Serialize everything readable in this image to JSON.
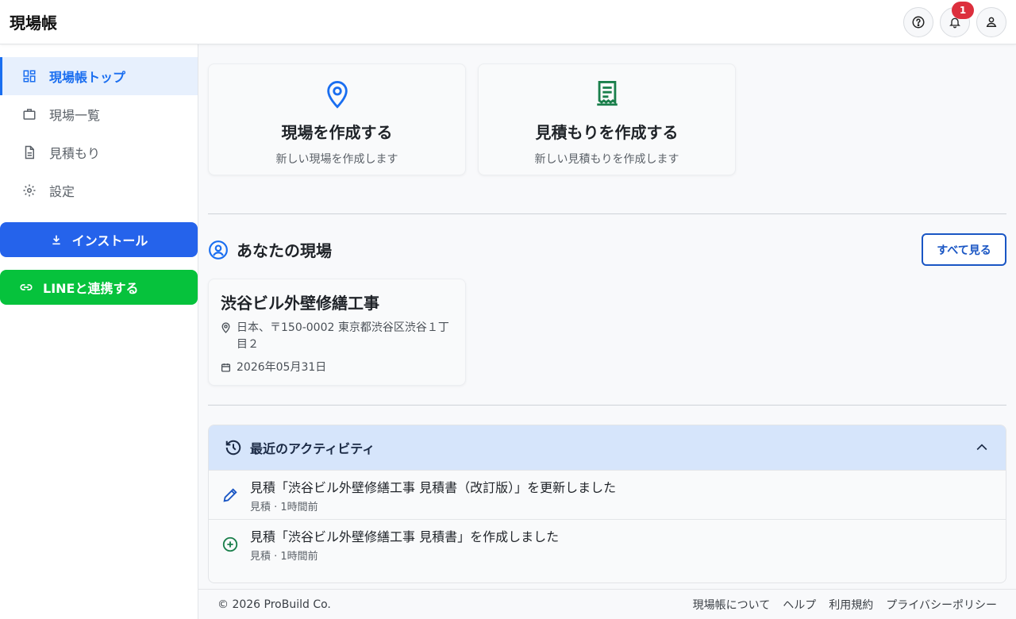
{
  "app": {
    "title": "現場帳"
  },
  "header": {
    "notification_count": "1",
    "icons": [
      "help-icon",
      "bell-icon",
      "user-icon"
    ]
  },
  "sidebar": {
    "items": [
      {
        "label": "現場帳トップ",
        "icon": "dashboard-icon",
        "active": true
      },
      {
        "label": "現場一覧",
        "icon": "briefcase-icon",
        "active": false
      },
      {
        "label": "見積もり",
        "icon": "document-icon",
        "active": false
      },
      {
        "label": "設定",
        "icon": "gear-icon",
        "active": false
      }
    ],
    "install_label": "インストール",
    "line_label": "LINEと連携する"
  },
  "actions": [
    {
      "title": "現場を作成する",
      "subtitle": "新しい現場を作成します",
      "icon": "location-pin-icon"
    },
    {
      "title": "見積もりを作成する",
      "subtitle": "新しい見積もりを作成します",
      "icon": "receipt-icon"
    }
  ],
  "my_sites": {
    "title": "あなたの現場",
    "see_all_label": "すべて見る",
    "sites": [
      {
        "name": "渋谷ビル外壁修繕工事",
        "address": "日本、〒150-0002 東京都渋谷区渋谷１丁目２",
        "date": "2026年05月31日"
      }
    ]
  },
  "activity": {
    "title": "最近のアクティビティ",
    "items": [
      {
        "text": "見積「渋谷ビル外壁修繕工事 見積書（改訂版）」を更新しました",
        "meta": "見積 · 1時間前",
        "icon": "pencil-icon"
      },
      {
        "text": "見積「渋谷ビル外壁修繕工事 見積書」を作成しました",
        "meta": "見積 · 1時間前",
        "icon": "plus-circle-icon"
      }
    ]
  },
  "footer": {
    "copyright": "© 2026 ProBuild Co.",
    "links": [
      "現場帳について",
      "ヘルプ",
      "利用規約",
      "プライバシーポリシー"
    ]
  },
  "colors": {
    "primary": "#2563eb",
    "line_green": "#06c23c",
    "badge_red": "#dc2f3d",
    "active_bg": "#e7f0fd"
  }
}
